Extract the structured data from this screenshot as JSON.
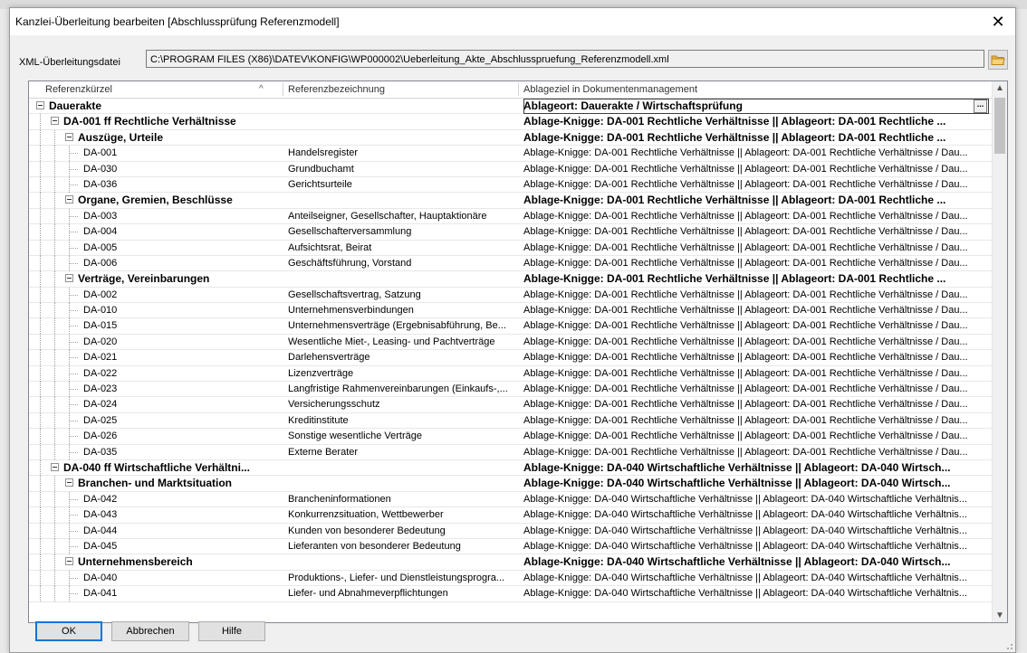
{
  "window": {
    "title": "Kanzlei-Überleitung bearbeiten [Abschlussprüfung Referenzmodell]",
    "close": "✕"
  },
  "xml": {
    "label": "XML-Überleitungsdatei",
    "value": "C:\\PROGRAM FILES (X86)\\DATEV\\KONFIG\\WP000002\\Ueberleitung_Akte_Abschlusspruefung_Referenzmodell.xml"
  },
  "grid": {
    "columns": [
      "Referenzkürzel",
      "Referenzbezeichnung",
      "Ablageziel in Dokumentenmanagement"
    ],
    "sort_indicator": "^",
    "ellipsis_button": "...",
    "rows": [
      {
        "level": 0,
        "kind": "group",
        "key": "Dauerakte",
        "name": "",
        "target": "Ablageort: Dauerakte / Wirtschaftsprüfung"
      },
      {
        "level": 1,
        "kind": "group",
        "key": "DA-001 ff  Rechtliche Verhältnisse",
        "name": "",
        "target": "Ablage-Knigge: DA-001 Rechtliche Verhältnisse || Ablageort: DA-001 Rechtliche ..."
      },
      {
        "level": 2,
        "kind": "group",
        "key": "Auszüge, Urteile",
        "name": "",
        "target": "Ablage-Knigge: DA-001 Rechtliche Verhältnisse || Ablageort: DA-001 Rechtliche ..."
      },
      {
        "level": 3,
        "kind": "item",
        "key": "DA-001",
        "name": "Handelsregister",
        "target": "Ablage-Knigge: DA-001 Rechtliche Verhältnisse || Ablageort: DA-001 Rechtliche Verhältnisse / Dau..."
      },
      {
        "level": 3,
        "kind": "item",
        "key": "DA-030",
        "name": "Grundbuchamt",
        "target": "Ablage-Knigge: DA-001 Rechtliche Verhältnisse || Ablageort: DA-001 Rechtliche Verhältnisse / Dau..."
      },
      {
        "level": 3,
        "kind": "item",
        "key": "DA-036",
        "name": "Gerichtsurteile",
        "target": "Ablage-Knigge: DA-001 Rechtliche Verhältnisse || Ablageort: DA-001 Rechtliche Verhältnisse / Dau..."
      },
      {
        "level": 2,
        "kind": "group",
        "key": "Organe, Gremien, Beschlüsse",
        "name": "",
        "target": "Ablage-Knigge: DA-001 Rechtliche Verhältnisse || Ablageort: DA-001 Rechtliche ..."
      },
      {
        "level": 3,
        "kind": "item",
        "key": "DA-003",
        "name": "Anteilseigner, Gesellschafter, Hauptaktionäre",
        "target": "Ablage-Knigge: DA-001 Rechtliche Verhältnisse || Ablageort: DA-001 Rechtliche Verhältnisse / Dau..."
      },
      {
        "level": 3,
        "kind": "item",
        "key": "DA-004",
        "name": "Gesellschafterversammlung",
        "target": "Ablage-Knigge: DA-001 Rechtliche Verhältnisse || Ablageort: DA-001 Rechtliche Verhältnisse / Dau..."
      },
      {
        "level": 3,
        "kind": "item",
        "key": "DA-005",
        "name": "Aufsichtsrat, Beirat",
        "target": "Ablage-Knigge: DA-001 Rechtliche Verhältnisse || Ablageort: DA-001 Rechtliche Verhältnisse / Dau..."
      },
      {
        "level": 3,
        "kind": "item",
        "key": "DA-006",
        "name": "Geschäftsführung, Vorstand",
        "target": "Ablage-Knigge: DA-001 Rechtliche Verhältnisse || Ablageort: DA-001 Rechtliche Verhältnisse / Dau..."
      },
      {
        "level": 2,
        "kind": "group",
        "key": "Verträge, Vereinbarungen",
        "name": "",
        "target": "Ablage-Knigge: DA-001 Rechtliche Verhältnisse || Ablageort: DA-001 Rechtliche ..."
      },
      {
        "level": 3,
        "kind": "item",
        "key": "DA-002",
        "name": "Gesellschaftsvertrag, Satzung",
        "target": "Ablage-Knigge: DA-001 Rechtliche Verhältnisse || Ablageort: DA-001 Rechtliche Verhältnisse / Dau..."
      },
      {
        "level": 3,
        "kind": "item",
        "key": "DA-010",
        "name": "Unternehmensverbindungen",
        "target": "Ablage-Knigge: DA-001 Rechtliche Verhältnisse || Ablageort: DA-001 Rechtliche Verhältnisse / Dau..."
      },
      {
        "level": 3,
        "kind": "item",
        "key": "DA-015",
        "name": "Unternehmensverträge (Ergebnisabführung, Be...",
        "target": "Ablage-Knigge: DA-001 Rechtliche Verhältnisse || Ablageort: DA-001 Rechtliche Verhältnisse / Dau..."
      },
      {
        "level": 3,
        "kind": "item",
        "key": "DA-020",
        "name": "Wesentliche Miet-, Leasing- und Pachtverträge",
        "target": "Ablage-Knigge: DA-001 Rechtliche Verhältnisse || Ablageort: DA-001 Rechtliche Verhältnisse / Dau..."
      },
      {
        "level": 3,
        "kind": "item",
        "key": "DA-021",
        "name": "Darlehensverträge",
        "target": "Ablage-Knigge: DA-001 Rechtliche Verhältnisse || Ablageort: DA-001 Rechtliche Verhältnisse / Dau..."
      },
      {
        "level": 3,
        "kind": "item",
        "key": "DA-022",
        "name": "Lizenzverträge",
        "target": "Ablage-Knigge: DA-001 Rechtliche Verhältnisse || Ablageort: DA-001 Rechtliche Verhältnisse / Dau..."
      },
      {
        "level": 3,
        "kind": "item",
        "key": "DA-023",
        "name": "Langfristige Rahmenvereinbarungen (Einkaufs-,...",
        "target": "Ablage-Knigge: DA-001 Rechtliche Verhältnisse || Ablageort: DA-001 Rechtliche Verhältnisse / Dau..."
      },
      {
        "level": 3,
        "kind": "item",
        "key": "DA-024",
        "name": "Versicherungsschutz",
        "target": "Ablage-Knigge: DA-001 Rechtliche Verhältnisse || Ablageort: DA-001 Rechtliche Verhältnisse / Dau..."
      },
      {
        "level": 3,
        "kind": "item",
        "key": "DA-025",
        "name": "Kreditinstitute",
        "target": "Ablage-Knigge: DA-001 Rechtliche Verhältnisse || Ablageort: DA-001 Rechtliche Verhältnisse / Dau..."
      },
      {
        "level": 3,
        "kind": "item",
        "key": "DA-026",
        "name": "Sonstige wesentliche Verträge",
        "target": "Ablage-Knigge: DA-001 Rechtliche Verhältnisse || Ablageort: DA-001 Rechtliche Verhältnisse / Dau..."
      },
      {
        "level": 3,
        "kind": "item",
        "key": "DA-035",
        "name": "Externe Berater",
        "target": "Ablage-Knigge: DA-001 Rechtliche Verhältnisse || Ablageort: DA-001 Rechtliche Verhältnisse / Dau..."
      },
      {
        "level": 1,
        "kind": "group",
        "key": "DA-040 ff  Wirtschaftliche Verhältni...",
        "name": "",
        "target": "Ablage-Knigge: DA-040 Wirtschaftliche Verhältnisse || Ablageort: DA-040 Wirtsch..."
      },
      {
        "level": 2,
        "kind": "group",
        "key": "Branchen- und Marktsituation",
        "name": "",
        "target": "Ablage-Knigge: DA-040 Wirtschaftliche Verhältnisse || Ablageort: DA-040 Wirtsch..."
      },
      {
        "level": 3,
        "kind": "item",
        "key": "DA-042",
        "name": "Brancheninformationen",
        "target": "Ablage-Knigge: DA-040 Wirtschaftliche Verhältnisse || Ablageort: DA-040 Wirtschaftliche Verhältnis..."
      },
      {
        "level": 3,
        "kind": "item",
        "key": "DA-043",
        "name": "Konkurrenzsituation, Wettbewerber",
        "target": "Ablage-Knigge: DA-040 Wirtschaftliche Verhältnisse || Ablageort: DA-040 Wirtschaftliche Verhältnis..."
      },
      {
        "level": 3,
        "kind": "item",
        "key": "DA-044",
        "name": "Kunden von besonderer Bedeutung",
        "target": "Ablage-Knigge: DA-040 Wirtschaftliche Verhältnisse || Ablageort: DA-040 Wirtschaftliche Verhältnis..."
      },
      {
        "level": 3,
        "kind": "item",
        "key": "DA-045",
        "name": "Lieferanten von besonderer Bedeutung",
        "target": "Ablage-Knigge: DA-040 Wirtschaftliche Verhältnisse || Ablageort: DA-040 Wirtschaftliche Verhältnis..."
      },
      {
        "level": 2,
        "kind": "group",
        "key": "Unternehmensbereich",
        "name": "",
        "target": "Ablage-Knigge: DA-040 Wirtschaftliche Verhältnisse || Ablageort: DA-040 Wirtsch..."
      },
      {
        "level": 3,
        "kind": "item",
        "key": "DA-040",
        "name": "Produktions-, Liefer- und Dienstleistungsprogra...",
        "target": "Ablage-Knigge: DA-040 Wirtschaftliche Verhältnisse || Ablageort: DA-040 Wirtschaftliche Verhältnis..."
      },
      {
        "level": 3,
        "kind": "item",
        "key": "DA-041",
        "name": "Liefer- und Abnahmeverpflichtungen",
        "target": "Ablage-Knigge: DA-040 Wirtschaftliche Verhältnisse || Ablageort: DA-040 Wirtschaftliche Verhältnis..."
      }
    ]
  },
  "buttons": {
    "ok": "OK",
    "cancel": "Abbrechen",
    "help": "Hilfe"
  }
}
